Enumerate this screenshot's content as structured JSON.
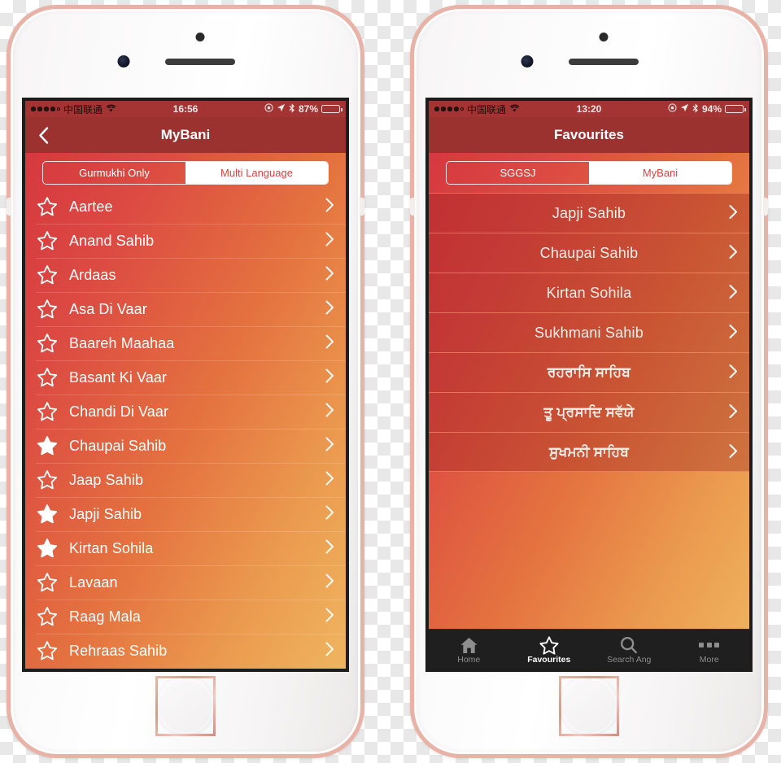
{
  "phones": [
    {
      "id": "left",
      "status_bar": {
        "carrier": "中国联通",
        "signal_dots_filled": 4,
        "signal_dots_total": 5,
        "wifi_icon": "wifi-icon",
        "time": "16:56",
        "alarm_icon": "alarm-icon",
        "location_icon": "location-arrow-icon",
        "bluetooth_icon": "bluetooth-icon",
        "battery_percent": "87%",
        "battery_level": 87
      },
      "nav": {
        "back_icon": "chevron-left-icon",
        "title": "MyBani"
      },
      "segmented": {
        "options": [
          "Gurmukhi Only",
          "Multi Language"
        ],
        "selected_index": 1
      },
      "list": [
        {
          "label": "Aartee",
          "favourite": false,
          "chevron": "chevron-right-icon"
        },
        {
          "label": "Anand Sahib",
          "favourite": false,
          "chevron": "chevron-right-icon"
        },
        {
          "label": "Ardaas",
          "favourite": false,
          "chevron": "chevron-right-icon"
        },
        {
          "label": "Asa Di Vaar",
          "favourite": false,
          "chevron": "chevron-right-icon"
        },
        {
          "label": "Baareh Maahaa",
          "favourite": false,
          "chevron": "chevron-right-icon"
        },
        {
          "label": "Basant Ki Vaar",
          "favourite": false,
          "chevron": "chevron-right-icon"
        },
        {
          "label": "Chandi Di Vaar",
          "favourite": false,
          "chevron": "chevron-right-icon"
        },
        {
          "label": "Chaupai Sahib",
          "favourite": true,
          "chevron": "chevron-right-icon"
        },
        {
          "label": "Jaap Sahib",
          "favourite": false,
          "chevron": "chevron-right-icon"
        },
        {
          "label": "Japji Sahib",
          "favourite": true,
          "chevron": "chevron-right-icon"
        },
        {
          "label": "Kirtan Sohila",
          "favourite": true,
          "chevron": "chevron-right-icon"
        },
        {
          "label": "Lavaan",
          "favourite": false,
          "chevron": "chevron-right-icon"
        },
        {
          "label": "Raag Mala",
          "favourite": false,
          "chevron": "chevron-right-icon"
        },
        {
          "label": "Rehraas Sahib",
          "favourite": false,
          "chevron": "chevron-right-icon"
        }
      ],
      "tabbar": null
    },
    {
      "id": "right",
      "status_bar": {
        "carrier": "中国联通",
        "signal_dots_filled": 4,
        "signal_dots_total": 5,
        "wifi_icon": "wifi-icon",
        "time": "13:20",
        "alarm_icon": "alarm-icon",
        "location_icon": "location-arrow-icon",
        "bluetooth_icon": "bluetooth-icon",
        "battery_percent": "94%",
        "battery_level": 94
      },
      "nav": {
        "back_icon": null,
        "title": "Favourites"
      },
      "segmented": {
        "options": [
          "SGGSJ",
          "MyBani"
        ],
        "selected_index": 1
      },
      "list": [
        {
          "label": "Japji Sahib",
          "gurmukhi": false,
          "chevron": "chevron-right-icon"
        },
        {
          "label": "Chaupai Sahib",
          "gurmukhi": false,
          "chevron": "chevron-right-icon"
        },
        {
          "label": "Kirtan Sohila",
          "gurmukhi": false,
          "chevron": "chevron-right-icon"
        },
        {
          "label": "Sukhmani Sahib",
          "gurmukhi": false,
          "chevron": "chevron-right-icon"
        },
        {
          "label": "ਰਹਰਾਸਿ ਸਾਹਿਬ",
          "gurmukhi": true,
          "chevron": "chevron-right-icon"
        },
        {
          "label": "ਤੂ ਪ੍ਰਸਾਦਿ ਸਵੱਯੇ",
          "gurmukhi": true,
          "chevron": "chevron-right-icon"
        },
        {
          "label": "ਸੁਖਮਨੀ ਸਾਹਿਬ",
          "gurmukhi": true,
          "chevron": "chevron-right-icon"
        }
      ],
      "tabbar": {
        "items": [
          {
            "label": "Home",
            "icon": "home-icon",
            "active": false
          },
          {
            "label": "Favourites",
            "icon": "star-icon",
            "active": true
          },
          {
            "label": "Search Ang",
            "icon": "search-icon",
            "active": false
          },
          {
            "label": "More",
            "icon": "ellipsis-icon",
            "active": false
          }
        ]
      }
    }
  ],
  "colors": {
    "gradient_start": "#d6383f",
    "gradient_end": "#efb55f",
    "navbar": "#9c3230",
    "statusbar": "#a43434",
    "tabbar": "#1f1f1f",
    "accent_white": "#ffffff",
    "frame_rose_gold": "#e8b2a6"
  }
}
